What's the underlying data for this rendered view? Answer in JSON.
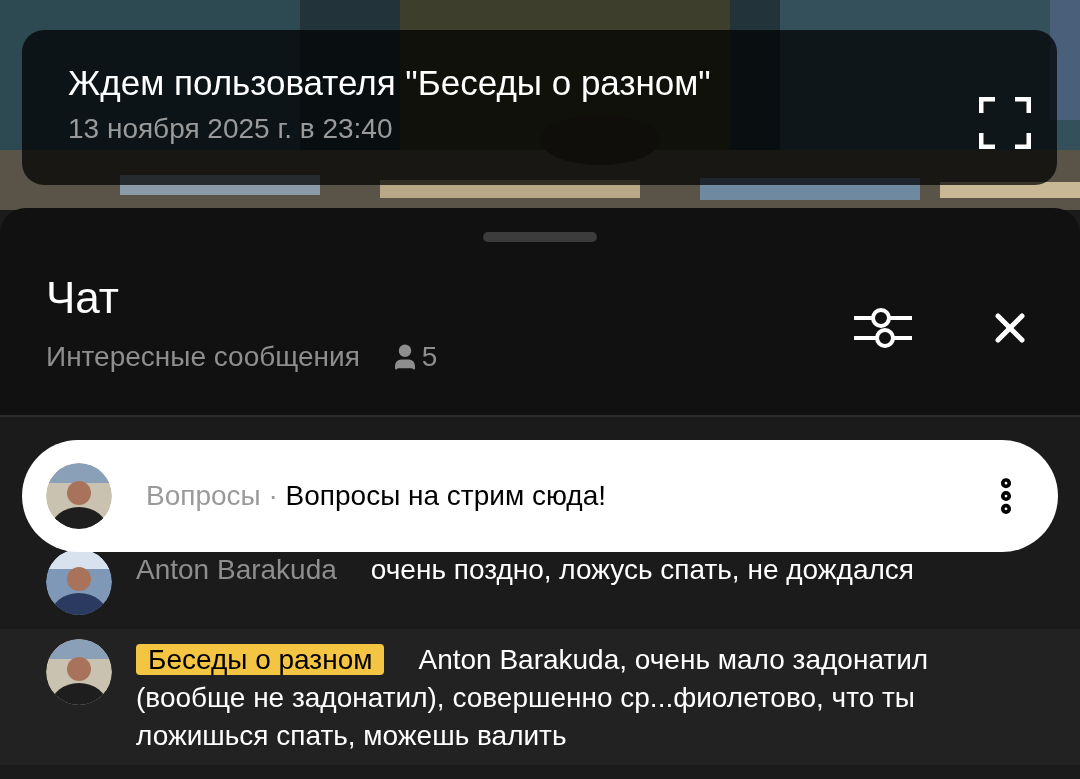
{
  "stream": {
    "title": "Ждем пользователя \"Беседы о разном\"",
    "date": "13 ноября 2025 г. в 23:40"
  },
  "chat": {
    "title": "Чат",
    "subtitle": "Интересные сообщения",
    "viewers": "5"
  },
  "pinned": {
    "author": "Вопросы",
    "separator": "·",
    "text": "Вопросы на стрим сюда!"
  },
  "messages": [
    {
      "author": "Anton Barakuda",
      "highlighted": false,
      "text": "очень поздно, ложусь спать, не дождался"
    },
    {
      "author": "Беседы о разном",
      "highlighted": true,
      "text": "Anton Barakuda, очень мало задонатил (вообще не задонатил), совершенно ср...фиолетово, что ты ложишься спать, можешь валить"
    }
  ]
}
